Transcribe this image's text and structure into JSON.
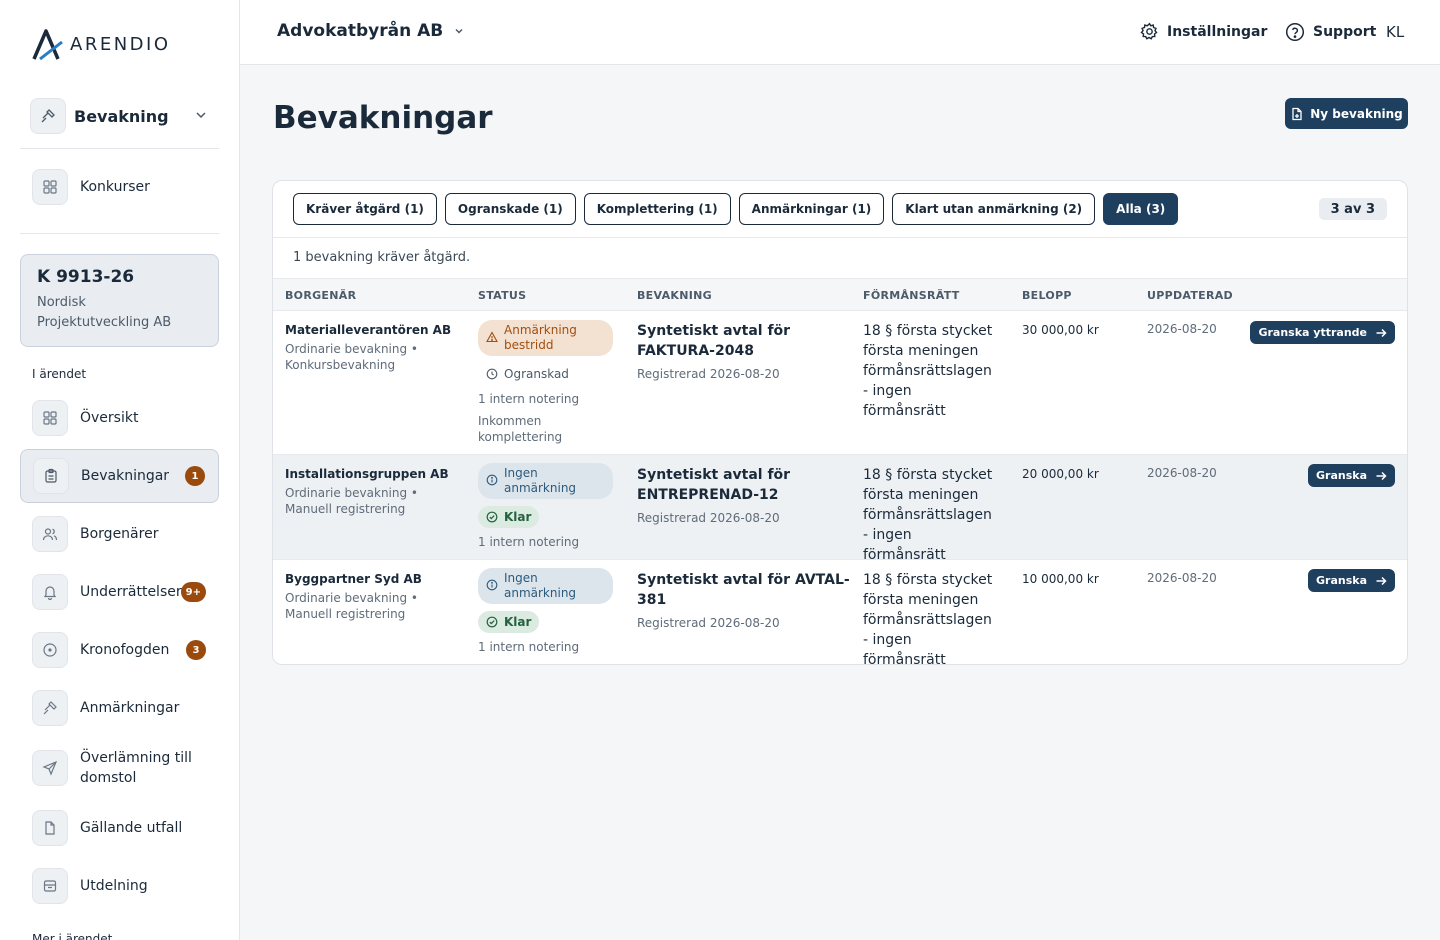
{
  "app": {
    "logo_text": "ARENDIO"
  },
  "sidebar": {
    "module": "Bevakning",
    "top_items": [
      {
        "label": "Konkurser",
        "icon": "grid-icon"
      }
    ],
    "case": {
      "number": "K 9913-26",
      "name": "Nordisk Projektutveckling AB"
    },
    "section_label": "I ärendet",
    "items": [
      {
        "label": "Översikt",
        "icon": "grid-icon"
      },
      {
        "label": "Bevakningar",
        "icon": "clipboard-icon",
        "badge": "1",
        "active": true
      },
      {
        "label": "Borgenärer",
        "icon": "users-icon"
      },
      {
        "label": "Underrättelser",
        "icon": "bell-icon",
        "badge": "9+"
      },
      {
        "label": "Kronofogden",
        "icon": "circle-dot-icon",
        "badge": "3"
      },
      {
        "label": "Anmärkningar",
        "icon": "gavel-icon"
      },
      {
        "label": "Överlämning till domstol",
        "icon": "send-icon"
      },
      {
        "label": "Gällande utfall",
        "icon": "document-icon"
      },
      {
        "label": "Utdelning",
        "icon": "archive-icon"
      }
    ],
    "more_label": "Mer i ärendet"
  },
  "topbar": {
    "org": "Advokatbyrån AB",
    "settings": "Inställningar",
    "support": "Support",
    "user": "KL"
  },
  "main": {
    "title": "Bevakningar",
    "new_button": "Ny bevakning",
    "filters": [
      {
        "label": "Kräver åtgärd (1)"
      },
      {
        "label": "Ogranskade (1)"
      },
      {
        "label": "Komplettering (1)"
      },
      {
        "label": "Anmärkningar (1)"
      },
      {
        "label": "Klart utan anmärkning (2)"
      },
      {
        "label": "Alla (3)",
        "active": true
      }
    ],
    "count": "3 av 3",
    "notice": "1 bevakning kräver åtgärd.",
    "columns": [
      "BORGENÄR",
      "STATUS",
      "BEVAKNING",
      "FÖRMÅNSRÄTT",
      "BELOPP",
      "UPPDATERAD"
    ],
    "rows": [
      {
        "creditor": "Materialleverantören AB",
        "creditor_sub": "Ordinarie bevakning • Konkursbevakning",
        "status_main": "Anmärkning bestridd",
        "status_main_tone": "warning",
        "status_secondary": "Ogranskad",
        "notes": "1 intern notering",
        "extra_note": "Inkommen komplettering",
        "agreement": "Syntetiskt avtal för FAKTURA-2048",
        "registered": "Registrerad 2026-08-20",
        "priority": "18 § första stycket första meningen förmånsrättslagen - ingen förmånsrätt",
        "amount": "30 000,00 kr",
        "updated": "2026-08-20",
        "action": "Granska yttrande"
      },
      {
        "creditor": "Installationsgruppen AB",
        "creditor_sub": "Ordinarie bevakning • Manuell registrering",
        "status_main": "Ingen anmärkning",
        "status_main_tone": "info",
        "status_secondary": "Klar",
        "notes": "1 intern notering",
        "agreement": "Syntetiskt avtal för ENTREPRENAD-12",
        "registered": "Registrerad 2026-08-20",
        "priority": "18 § första stycket första meningen förmånsrättslagen - ingen förmånsrätt",
        "amount": "20 000,00 kr",
        "updated": "2026-08-20",
        "action": "Granska"
      },
      {
        "creditor": "Byggpartner Syd AB",
        "creditor_sub": "Ordinarie bevakning • Manuell registrering",
        "status_main": "Ingen anmärkning",
        "status_main_tone": "info",
        "status_secondary": "Klar",
        "notes": "1 intern notering",
        "agreement": "Syntetiskt avtal för AVTAL-381",
        "registered": "Registrerad 2026-08-20",
        "priority": "18 § första stycket första meningen förmånsrättslagen - ingen förmånsrätt",
        "amount": "10 000,00 kr",
        "updated": "2026-08-20",
        "action": "Granska"
      }
    ]
  },
  "colors": {
    "primary": "#1f3f5e",
    "badge": "#9a4a0c",
    "warning_bg": "#f3e1d2",
    "info_bg": "#dde5ec",
    "success_bg": "#dcebe2"
  }
}
